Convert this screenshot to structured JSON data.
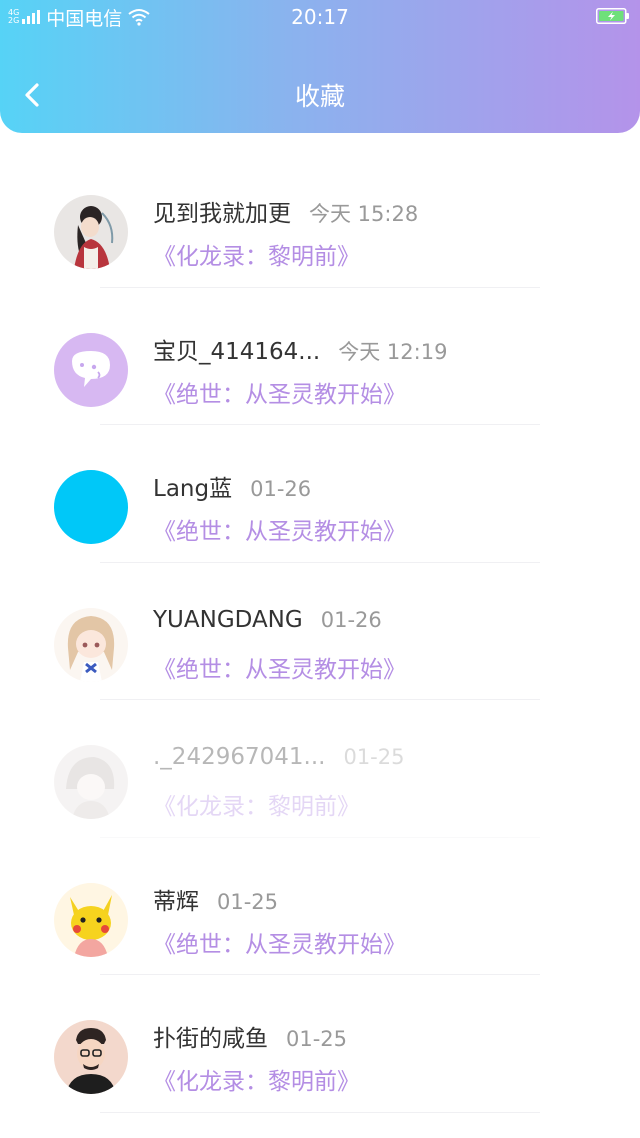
{
  "status_bar": {
    "network_top": "4G",
    "network_bottom": "2G",
    "carrier": "中国电信",
    "time": "20:17"
  },
  "header": {
    "title": "收藏",
    "back_icon": "chevron-left-icon",
    "gradient_start": "#56d3f6",
    "gradient_end": "#b493ea"
  },
  "colors": {
    "book_title": "#b48ee4",
    "name": "#333333",
    "time": "#999999"
  },
  "items": [
    {
      "name": "见到我就加更",
      "time": "今天 15:28",
      "book": "《化龙录：黎明前》",
      "avatar": "girl-illustration-avatar"
    },
    {
      "name": "宝贝_414164...",
      "time": "今天 12:19",
      "book": "《绝世：从圣灵教开始》",
      "avatar": "chat-bubble-avatar"
    },
    {
      "name": "Lang蓝",
      "time": "01-26",
      "book": "《绝世：从圣灵教开始》",
      "avatar": "blue-circle-avatar"
    },
    {
      "name": "YUANGDANG",
      "time": "01-26",
      "book": "《绝世：从圣灵教开始》",
      "avatar": "anime-girl-avatar"
    },
    {
      "name": "._242967041...",
      "time": "01-25",
      "book": "《化龙录：黎明前》",
      "avatar": "faded-anime-avatar",
      "faded": true
    },
    {
      "name": "蒂辉",
      "time": "01-25",
      "book": "《绝世：从圣灵教开始》",
      "avatar": "pikachu-avatar"
    },
    {
      "name": "扑街的咸鱼",
      "time": "01-25",
      "book": "《化龙录：黎明前》",
      "avatar": "cartoon-man-avatar"
    }
  ]
}
